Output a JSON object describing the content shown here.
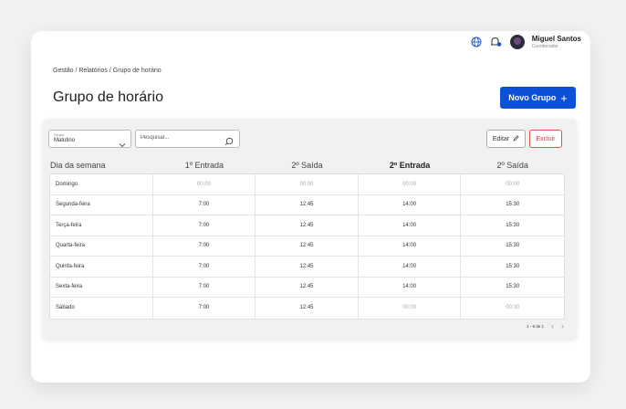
{
  "header": {
    "user_name": "Miguel Santos",
    "user_role": "Coordenador",
    "icons": [
      "globe-icon",
      "notification-icon",
      "avatar"
    ]
  },
  "breadcrumb": "Gestão / Relatórios / Grupo de horário",
  "page_title": "Grupo de horário",
  "new_button_label": "Novo Grupo",
  "new_button_icon": "+",
  "filters": {
    "group_label": "Grupo",
    "group_value": "Matutino",
    "search_placeholder": "Pesquisar..."
  },
  "actions": {
    "edit_label": "Editar",
    "delete_label": "Excluir"
  },
  "table": {
    "columns": [
      "Dia da semana",
      "1º Entrada",
      "2º Saída",
      "2º Entrada",
      "2º Saída"
    ],
    "rows": [
      [
        "Domingo",
        "00:00",
        "00:00",
        "00:00",
        "00:00"
      ],
      [
        "Segunda-feira",
        "7:00",
        "12:45",
        "14:00",
        "15:30"
      ],
      [
        "Terça-feira",
        "7:00",
        "12:45",
        "14:00",
        "15:30"
      ],
      [
        "Quarta-feira",
        "7:00",
        "12:45",
        "14:00",
        "15:30"
      ],
      [
        "Quinta-feira",
        "7:00",
        "12:45",
        "14:00",
        "15:30"
      ],
      [
        "Sexta-feira",
        "7:00",
        "12:45",
        "14:00",
        "15:30"
      ],
      [
        "Sábado",
        "7:00",
        "12:45",
        "00:00",
        "00:00"
      ]
    ]
  },
  "pagination": {
    "range_text": "1 - 9 de 1",
    "prev": "‹",
    "next": "›"
  },
  "colors": {
    "primary": "#0b50d6",
    "danger": "#d33333",
    "muted_text": "#aaaaaa"
  }
}
